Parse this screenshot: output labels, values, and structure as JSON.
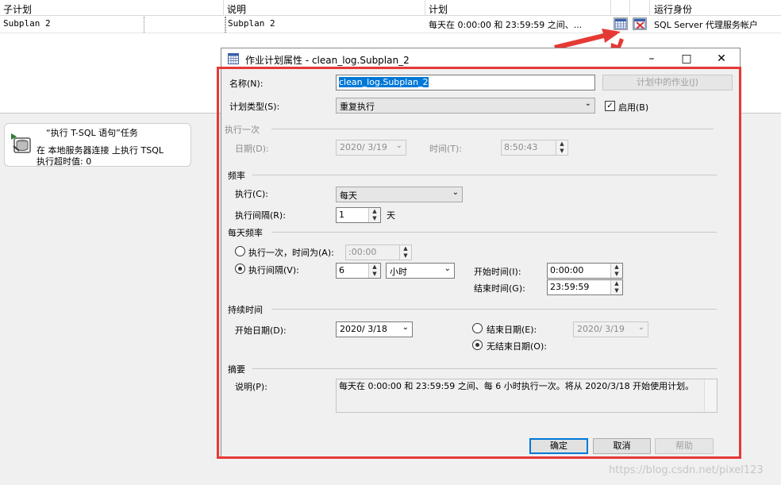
{
  "grid": {
    "headers": [
      "子计划",
      "说明",
      "计划",
      "运行身份"
    ],
    "row": {
      "subplan": "Subplan 2",
      "description": "Subplan 2",
      "schedule": "每天在 0:00:00 和 23:59:59 之间、...",
      "run_as": "SQL Server 代理服务帐户"
    },
    "icons": [
      "calendar-icon",
      "delete-schedule-icon"
    ]
  },
  "task_card": {
    "title": "“执行 T-SQL 语句”任务",
    "line1": "在 本地服务器连接 上执行 TSQL",
    "line2": "执行超时值: 0"
  },
  "dialog": {
    "title": "作业计划属性 - clean_log.Subplan_2",
    "name_label": "名称(N):",
    "name_value": "clean_log.Subplan_2",
    "jobs_button": "计划中的作业(J)",
    "schedule_type_label": "计划类型(S):",
    "schedule_type_value": "重复执行",
    "enabled_label": "启用(B)",
    "enabled_checked": true,
    "once": {
      "section": "执行一次",
      "date_label": "日期(D):",
      "date_value": "2020/ 3/19",
      "time_label": "时间(T):",
      "time_value": "8:50:43"
    },
    "frequency": {
      "section": "频率",
      "occurs_label": "执行(C):",
      "occurs_value": "每天",
      "recurs_label": "执行间隔(R):",
      "recurs_value": "1",
      "recurs_unit": "天"
    },
    "daily": {
      "section": "每天频率",
      "once_label": "执行一次，时间为(A):",
      "once_value": ":00:00",
      "every_label": "执行间隔(V):",
      "every_value": "6",
      "every_unit": "小时",
      "every_selected": true,
      "start_label": "开始时间(I):",
      "start_value": "0:00:00",
      "end_label": "结束时间(G):",
      "end_value": "23:59:59"
    },
    "duration": {
      "section": "持续时间",
      "start_label": "开始日期(D):",
      "start_value": "2020/ 3/18",
      "end_label": "结束日期(E):",
      "end_value": "2020/ 3/19",
      "no_end_label": "无结束日期(O):",
      "no_end_selected": true
    },
    "summary": {
      "section": "摘要",
      "desc_label": "说明(P):",
      "desc_value": "每天在 0:00:00 和 23:59:59 之间、每 6 小时执行一次。将从 2020/3/18 开始使用计划。"
    },
    "buttons": {
      "ok": "确定",
      "cancel": "取消",
      "help": "帮助"
    }
  },
  "watermark": "https://blog.csdn.net/pixel123",
  "colors": {
    "highlight_frame": "#e53935",
    "selection": "#0078d7"
  }
}
